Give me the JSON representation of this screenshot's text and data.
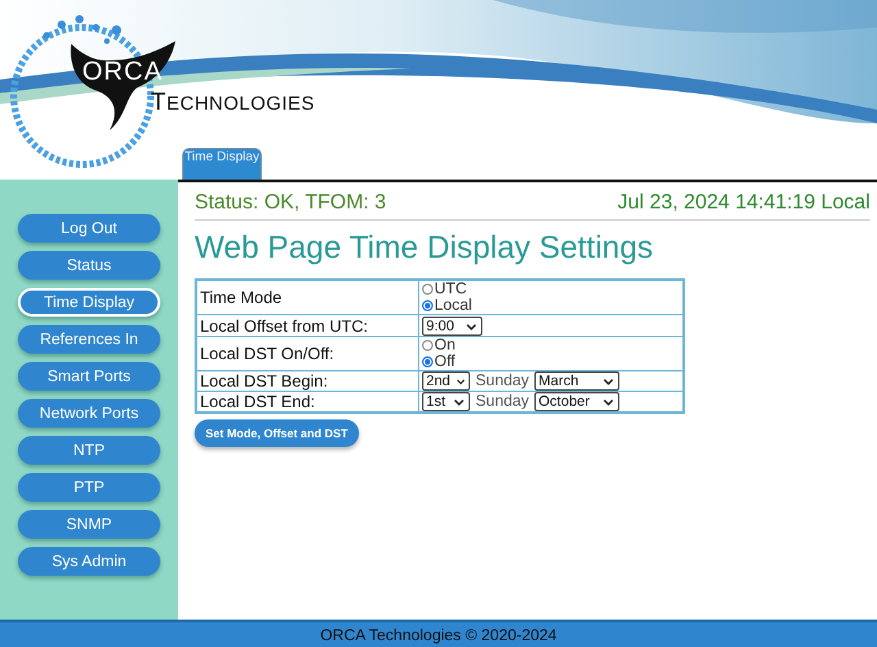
{
  "logo": {
    "word": "ORCA",
    "subword": "TECHNOLOGIES"
  },
  "tabs": [
    {
      "label": "Time Display",
      "selected": true
    }
  ],
  "status": {
    "text": "Status: OK, TFOM: 3",
    "clock": "Jul 23, 2024 14:41:19 Local"
  },
  "nav": [
    {
      "label": "Log Out",
      "selected": false
    },
    {
      "label": "Status",
      "selected": false
    },
    {
      "label": "Time Display",
      "selected": true
    },
    {
      "label": "References In",
      "selected": false
    },
    {
      "label": "Smart Ports",
      "selected": false
    },
    {
      "label": "Network Ports",
      "selected": false
    },
    {
      "label": "NTP",
      "selected": false
    },
    {
      "label": "PTP",
      "selected": false
    },
    {
      "label": "SNMP",
      "selected": false
    },
    {
      "label": "Sys Admin",
      "selected": false
    }
  ],
  "title": "Web Page Time Display Settings",
  "settings": [
    {
      "kind": "radio",
      "label": "Time Mode",
      "options": [
        {
          "label": "UTC",
          "selected": false
        },
        {
          "label": "Local",
          "selected": true
        }
      ]
    },
    {
      "kind": "select",
      "label": "Local Offset from UTC:",
      "value": "9:00"
    },
    {
      "kind": "radio",
      "label": "Local DST On/Off:",
      "options": [
        {
          "label": "On",
          "selected": false
        },
        {
          "label": "Off",
          "selected": true
        }
      ]
    },
    {
      "kind": "rule",
      "label": "Local DST Begin:",
      "week": "2nd",
      "day": "Sunday",
      "month": "March"
    },
    {
      "kind": "rule",
      "label": "Local DST End:",
      "week": "1st",
      "day": "Sunday",
      "month": "October"
    }
  ],
  "submit_button": "Set Mode, Offset and DST",
  "footer": "ORCA Technologies © 2020-2024"
}
